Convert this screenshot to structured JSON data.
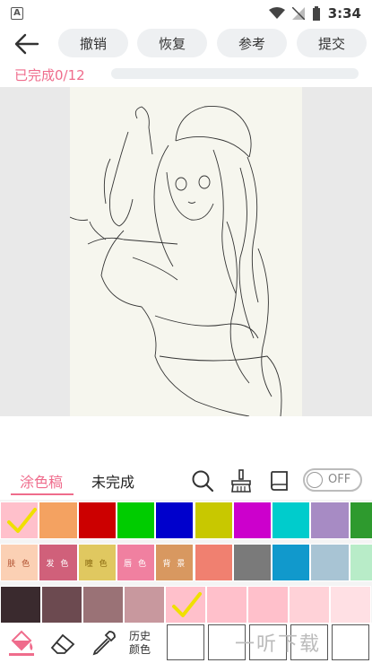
{
  "status_bar": {
    "time": "3:34"
  },
  "toolbar": {
    "undo_label": "撤销",
    "redo_label": "恢复",
    "reference_label": "参考",
    "submit_label": "提交"
  },
  "progress": {
    "text": "已完成0/12",
    "fraction": 0.0
  },
  "tabs": {
    "coloring_label": "涂色稿",
    "incomplete_label": "未完成",
    "toggle_label": "OFF"
  },
  "palette": {
    "row1": [
      "#ffc0cb",
      "#f4a261",
      "#cc0000",
      "#00cc00",
      "#0000cc",
      "#c8c800",
      "#cc00cc",
      "#00cccc",
      "#a78bc4",
      "#2e9a2e"
    ],
    "row2": [
      {
        "color": "#fbd0b4",
        "label": "肤 色",
        "text_color": "#b05030"
      },
      {
        "color": "#d0607a",
        "label": "发 色",
        "text_color": "#ffffff"
      },
      {
        "color": "#e0c860",
        "label": "瞳 色",
        "text_color": "#8a6a10"
      },
      {
        "color": "#f080a0",
        "label": "唇 色",
        "text_color": "#ffffff"
      },
      {
        "color": "#d89860",
        "label": "背 景",
        "text_color": "#ffffff"
      },
      {
        "color": "#f08070",
        "label": ""
      },
      {
        "color": "#7a7a7a",
        "label": ""
      },
      {
        "color": "#1199cc",
        "label": ""
      },
      {
        "color": "#a8c4d4",
        "label": ""
      },
      {
        "color": "#b8ecc8",
        "label": ""
      }
    ],
    "row3": [
      "#3a2a2e",
      "#6c4a50",
      "#9a7276",
      "#c8989e",
      "#ffc0cb",
      "#ffc0cb",
      "#ffc0cb",
      "#ffd2d8",
      "#ffe0e4"
    ]
  },
  "bottom": {
    "history_label_1": "历史",
    "history_label_2": "颜色",
    "watermark": "一听下载"
  }
}
